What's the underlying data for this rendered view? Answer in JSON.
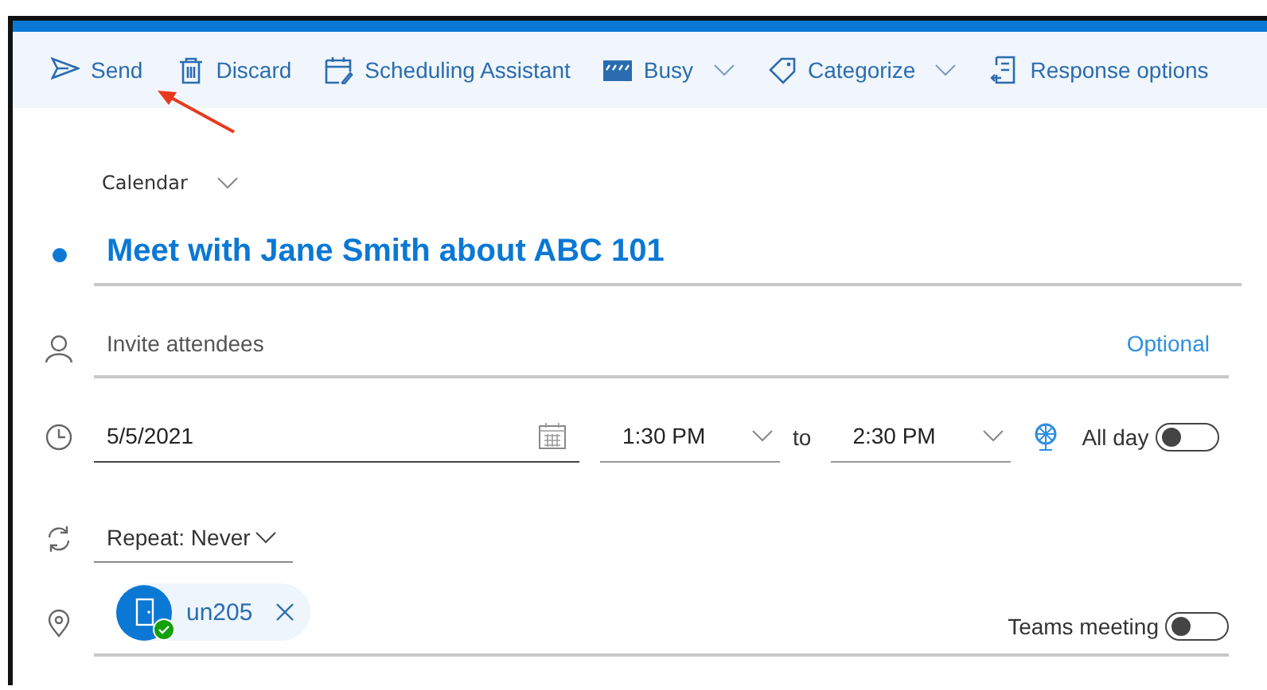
{
  "toolbar": [
    {
      "kind": "send",
      "label": "Send",
      "dropdown": false
    },
    {
      "kind": "discard",
      "label": "Discard",
      "dropdown": false
    },
    {
      "kind": "scheduling",
      "label": "Scheduling Assistant",
      "dropdown": false
    },
    {
      "kind": "busy",
      "label": "Busy",
      "dropdown": true
    },
    {
      "kind": "categorize",
      "label": "Categorize",
      "dropdown": true
    },
    {
      "kind": "response",
      "label": "Response options",
      "dropdown": false
    }
  ],
  "calendar": {
    "label": "Calendar"
  },
  "title": {
    "value": "Meet with Jane Smith about ABC 101"
  },
  "attendees": {
    "placeholder": "Invite attendees",
    "optional": "Optional"
  },
  "date": {
    "value": "5/5/2021",
    "start": "1:30 PM",
    "to": "to",
    "end": "2:30 PM",
    "all_day": {
      "label": "All day",
      "on": false
    }
  },
  "repeat": {
    "label": "Repeat:",
    "value": "Never"
  },
  "location": {
    "chips": [
      {
        "label": "un205",
        "available": true
      }
    ],
    "teams_meeting": {
      "label": "Teams meeting",
      "on": false
    }
  }
}
